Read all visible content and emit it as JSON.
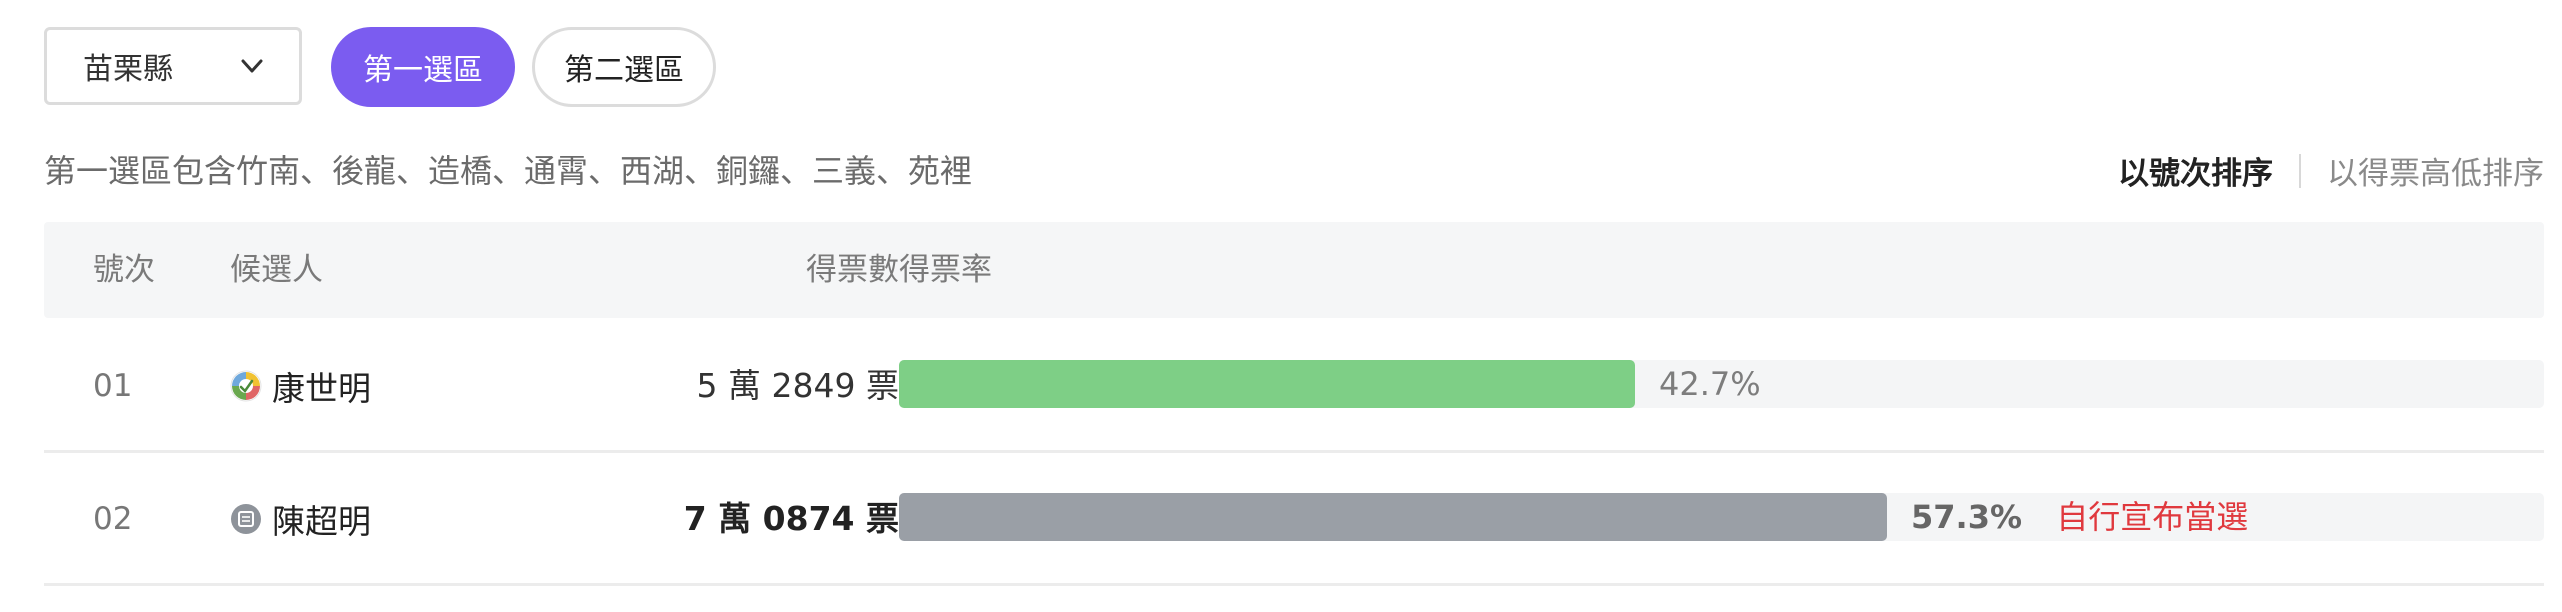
{
  "filters": {
    "county": "苗栗縣",
    "districts": [
      "第一選區",
      "第二選區"
    ],
    "active_district_index": 0
  },
  "description": "第一選區包含竹南、後龍、造橋、通霄、西湖、銅鑼、三義、苑裡",
  "sort": {
    "by_number": "以號次排序",
    "by_votes": "以得票高低排序"
  },
  "table": {
    "headers": {
      "number": "號次",
      "candidate": "候選人",
      "votes": "得票數",
      "rate": "得票率"
    },
    "rows": [
      {
        "number": "01",
        "name": "康世明",
        "party_icon": "party-icon-multicolor",
        "votes": "5 萬 2849 票",
        "rate_text": "42.7%",
        "rate": 42.7,
        "bar_color": "#7ecf86",
        "note": "",
        "bold": false
      },
      {
        "number": "02",
        "name": "陳超明",
        "party_icon": "party-icon-independent",
        "votes": "7 萬 0874 票",
        "rate_text": "57.3%",
        "rate": 57.3,
        "bar_color": "#9a9fa6",
        "note": "自行宣布當選",
        "bold": true
      }
    ]
  },
  "colors": {
    "accent": "#7b5cf0",
    "elected_text": "#e0393e"
  }
}
